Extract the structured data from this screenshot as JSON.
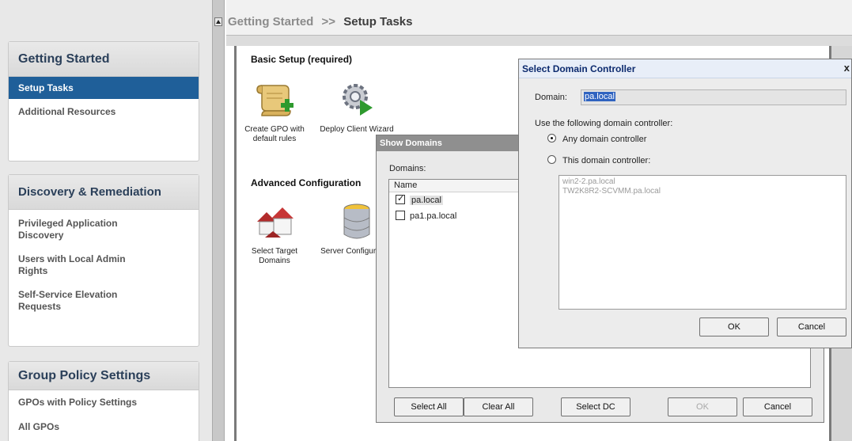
{
  "sidebar": {
    "sections": [
      {
        "title": "Getting Started",
        "items": [
          {
            "label": "Setup Tasks",
            "active": true
          },
          {
            "label": "Additional Resources"
          }
        ]
      },
      {
        "title": "Discovery & Remediation",
        "items": [
          {
            "label": "Privileged Application Discovery"
          },
          {
            "label": "Users with Local Admin Rights"
          },
          {
            "label": "Self-Service Elevation Requests"
          }
        ]
      },
      {
        "title": "Group Policy Settings",
        "items": [
          {
            "label": "GPOs with Policy Settings"
          },
          {
            "label": "All GPOs"
          }
        ]
      }
    ]
  },
  "breadcrumb": {
    "parent": "Getting Started",
    "separator": ">>",
    "current": "Setup Tasks"
  },
  "main": {
    "basic_title": "Basic Setup (required)",
    "advanced_title": "Advanced Configuration",
    "tasks_basic": [
      {
        "label": "Create GPO with default rules",
        "icon": "scroll-add-icon"
      },
      {
        "label": "Deploy Client Wizard",
        "icon": "gear-play-icon"
      }
    ],
    "tasks_advanced": [
      {
        "label": "Select Target Domains",
        "icon": "houses-icon"
      },
      {
        "label": "Server Configuration",
        "icon": "database-icon"
      }
    ]
  },
  "show_domains": {
    "title": "Show Domains",
    "domains_label": "Domains:",
    "column_name": "Name",
    "rows": [
      {
        "name": "pa.local",
        "checked": true
      },
      {
        "name": "pa1.pa.local",
        "checked": false
      }
    ],
    "buttons": {
      "select_all": "Select All",
      "clear_all": "Clear All",
      "select_dc": "Select DC",
      "ok": "OK",
      "cancel": "Cancel"
    }
  },
  "select_dc": {
    "title": "Select Domain Controller",
    "close": "x",
    "domain_label": "Domain:",
    "domain_value": "pa.local",
    "use_label": "Use the following domain controller:",
    "option_any": "Any domain controller",
    "option_this": "This domain controller:",
    "selected_option": "any",
    "controllers": [
      "win2-2.pa.local",
      "TW2K8R2-SCVMM.pa.local"
    ],
    "buttons": {
      "ok": "OK",
      "cancel": "Cancel"
    }
  }
}
